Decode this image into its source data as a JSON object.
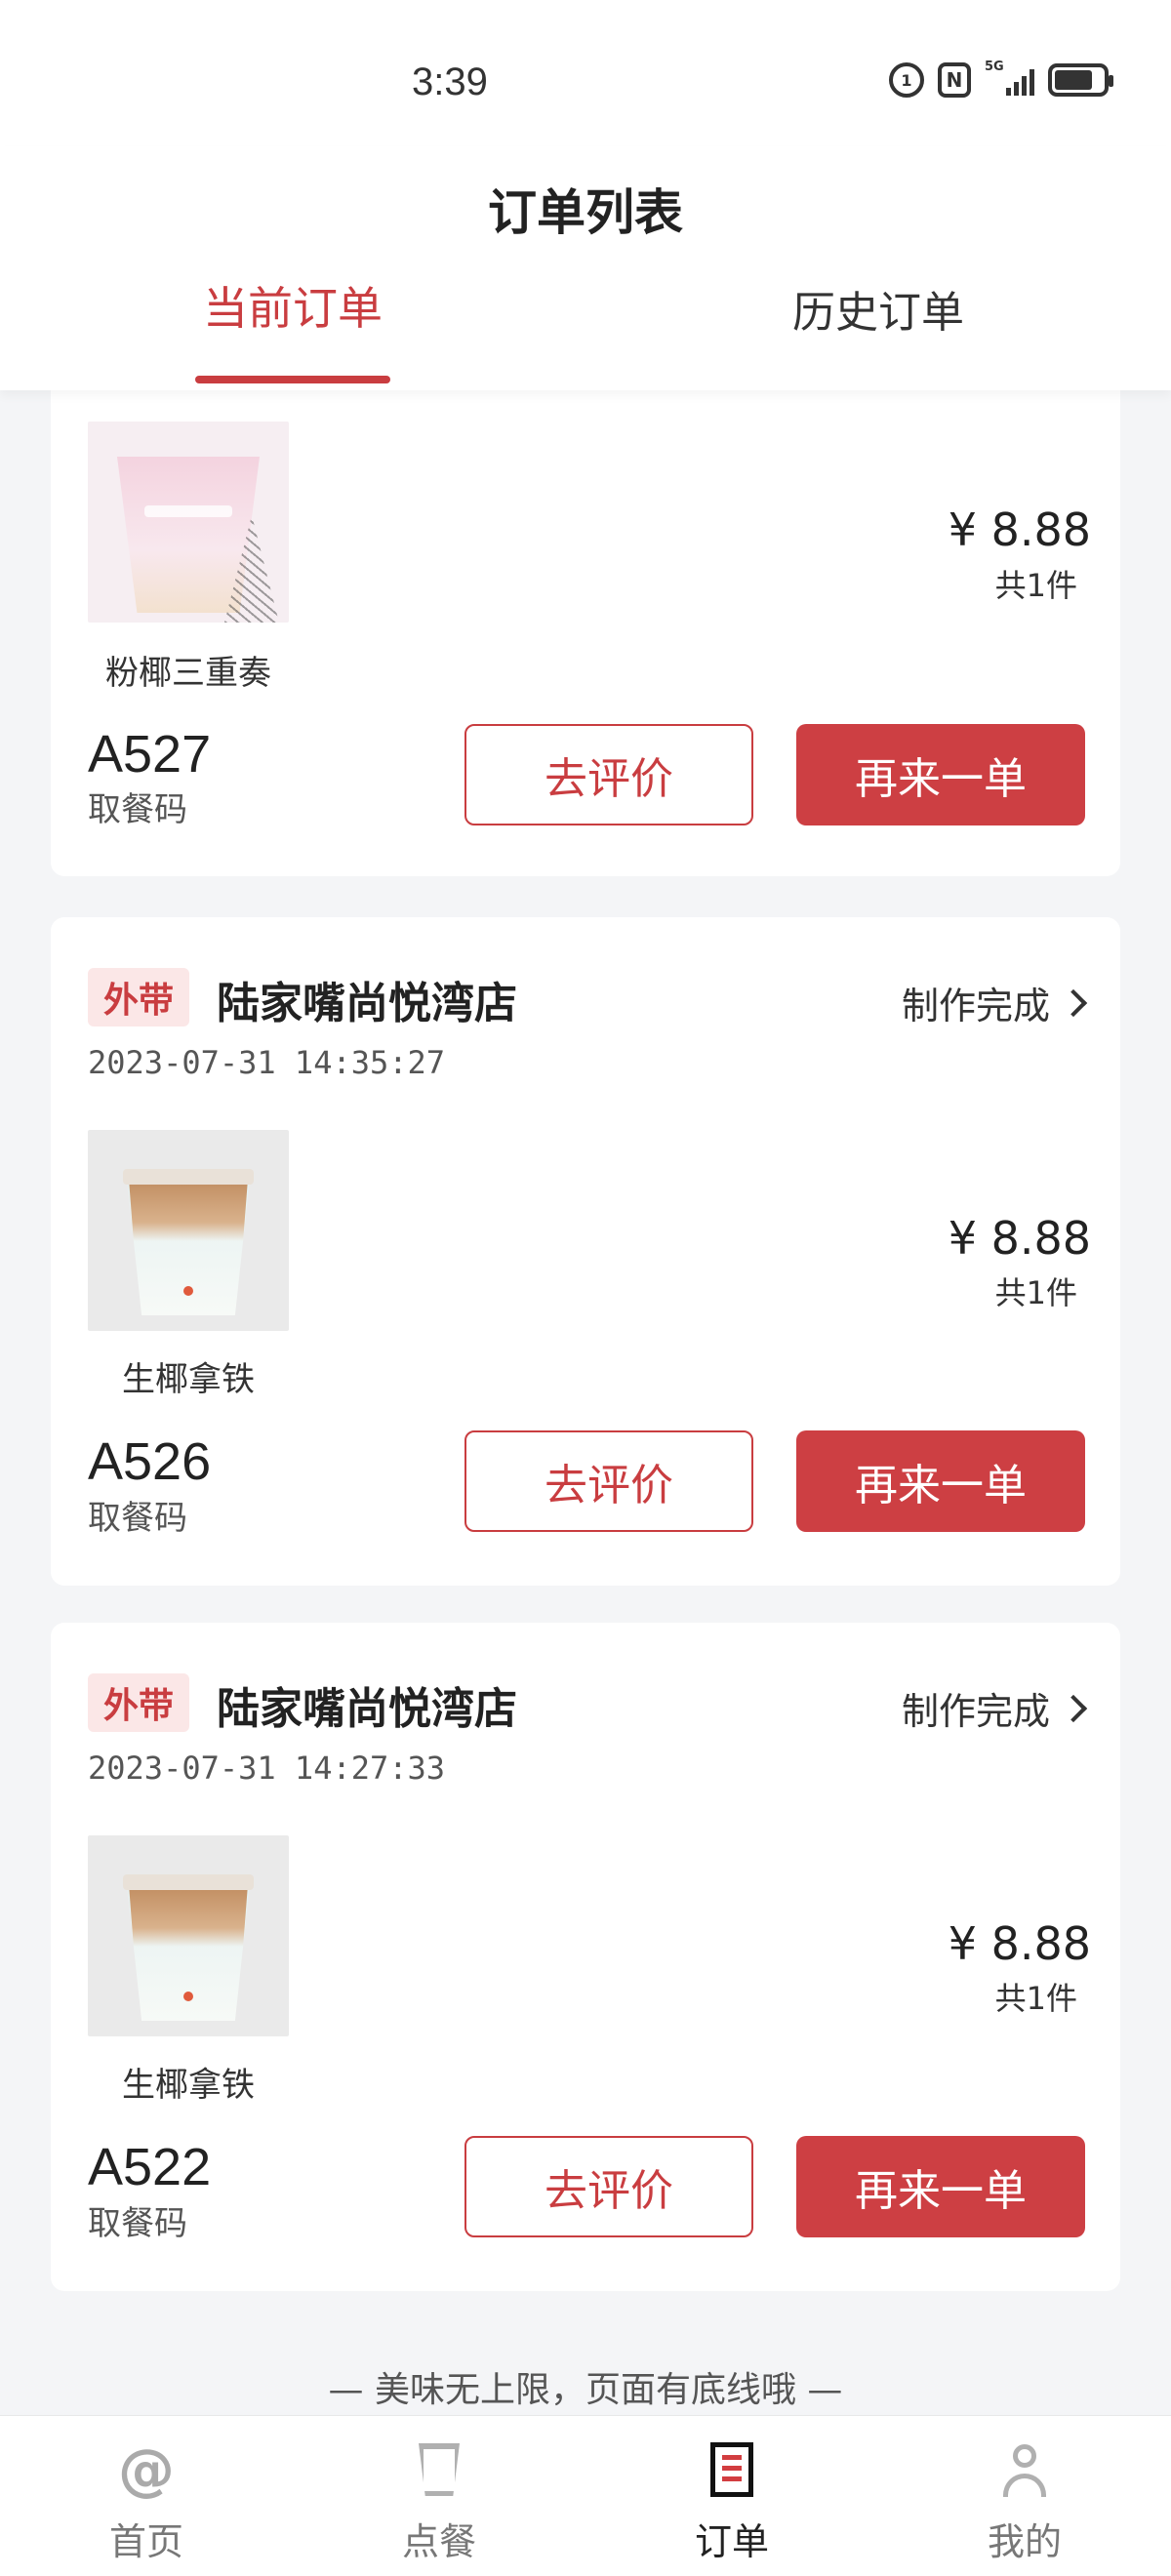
{
  "status_bar": {
    "time": "3:39",
    "signal_label": "5G"
  },
  "header": {
    "title": "订单列表",
    "tabs": [
      {
        "label": "当前订单",
        "active": true
      },
      {
        "label": "历史订单",
        "active": false
      }
    ]
  },
  "orders": [
    {
      "product_name": "粉椰三重奏",
      "price": "¥ 8.88",
      "quantity": "共1件",
      "pickup_code": "A527",
      "pickup_label": "取餐码",
      "review_button": "去评价",
      "reorder_button": "再来一单"
    },
    {
      "type": "外带",
      "store": "陆家嘴尚悦湾店",
      "status": "制作完成",
      "time": "2023-07-31 14:35:27",
      "product_name": "生椰拿铁",
      "price": "¥ 8.88",
      "quantity": "共1件",
      "pickup_code": "A526",
      "pickup_label": "取餐码",
      "review_button": "去评价",
      "reorder_button": "再来一单"
    },
    {
      "type": "外带",
      "store": "陆家嘴尚悦湾店",
      "status": "制作完成",
      "time": "2023-07-31 14:27:33",
      "product_name": "生椰拿铁",
      "price": "¥ 8.88",
      "quantity": "共1件",
      "pickup_code": "A522",
      "pickup_label": "取餐码",
      "review_button": "去评价",
      "reorder_button": "再来一单"
    }
  ],
  "end_note": "— 美味无上限，页面有底线哦 —",
  "bottom_nav": [
    {
      "label": "首页",
      "icon": "at-icon",
      "active": false
    },
    {
      "label": "点餐",
      "icon": "cup-icon",
      "active": false
    },
    {
      "label": "订单",
      "icon": "order-doc-icon",
      "active": true
    },
    {
      "label": "我的",
      "icon": "user-icon",
      "active": false
    }
  ],
  "colors": {
    "accent": "#c93d40",
    "badge_bg": "#fbe7e7",
    "page_bg": "#f4f5f7"
  }
}
